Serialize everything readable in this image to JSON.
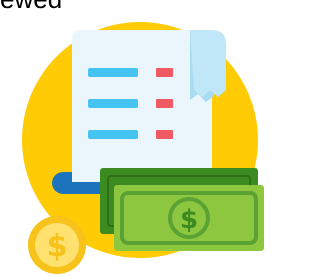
{
  "caption": "ewed",
  "colors": {
    "background_circle": "#FFCB05",
    "receipt_paper": "#EAF6FC",
    "receipt_fold": "#A9DCF3",
    "receipt_lines": "#45C4F2",
    "receipt_marks": "#EF5A62",
    "tray": "#1C75BC",
    "bill_back": "#3C8B21",
    "bill_front": "#8DC63F",
    "bill_dark": "#5AA233",
    "coin": "#F7C21A",
    "coin_light": "#FFE170"
  },
  "icons": {
    "main": "receipt-with-money-icon"
  }
}
